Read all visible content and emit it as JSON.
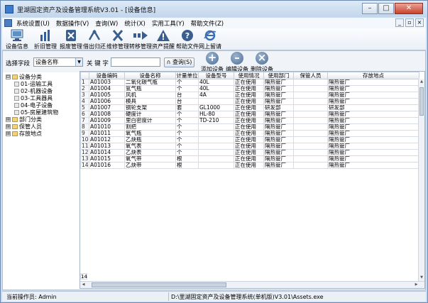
{
  "window": {
    "title": "里湖固定资产及设备管理系统V3.01 - [设备信息]",
    "buttons": {
      "minimize": "–",
      "maximize": "□",
      "close": "✕"
    }
  },
  "menubar": {
    "items": [
      "系统设置(U)",
      "数据操作(V)",
      "查询(W)",
      "统计(X)",
      "实用工具(Y)",
      "帮助文件(Z)"
    ],
    "mdi_buttons": [
      "_",
      "▫",
      "×"
    ]
  },
  "toolbar": {
    "items": [
      {
        "label": "设备信息",
        "icon": "monitor-icon"
      },
      {
        "label": "折旧管理",
        "icon": "barchart-icon"
      },
      {
        "label": "报废管理",
        "icon": "scrap-icon"
      },
      {
        "label": "借出归还",
        "icon": "lend-icon"
      },
      {
        "label": "维修管理",
        "icon": "tools-icon"
      },
      {
        "label": "转移管理",
        "icon": "transfer-icon"
      },
      {
        "label": "资产提醒",
        "icon": "warning-icon"
      },
      {
        "label": "帮助文件",
        "icon": "help-icon"
      },
      {
        "label": "网上留请",
        "icon": "ie-icon"
      }
    ]
  },
  "search": {
    "field_label": "选择字段",
    "field_value": "设备名称",
    "keyword_label": "关 键 字",
    "keyword_value": "",
    "query_button": "查询(S)"
  },
  "actions": {
    "add": "添加设备",
    "edit": "编辑设备",
    "delete": "删除设备"
  },
  "tree": [
    {
      "label": "设备分类",
      "expander": "⊟",
      "level": 0
    },
    {
      "label": "01-运输工具",
      "level": 1
    },
    {
      "label": "02-机器设备",
      "level": 1
    },
    {
      "label": "03-工具器具",
      "level": 1
    },
    {
      "label": "04-电子设备",
      "level": 1
    },
    {
      "label": "05-房屋建筑物",
      "level": 1
    },
    {
      "label": "部门分类",
      "expander": "⊞",
      "level": 0
    },
    {
      "label": "保管人员",
      "expander": "⊞",
      "level": 0
    },
    {
      "label": "存放地点",
      "expander": "⊞",
      "level": 0
    }
  ],
  "table": {
    "columns": [
      "",
      "设备编码",
      "设备名称",
      "计量单位",
      "设备型号",
      "使用情况",
      "使用部门",
      "保管人员",
      "存放地点"
    ],
    "rows": [
      [
        "1",
        "A01003",
        "二氧化碳气瓶",
        "个",
        "40L",
        "正在使用",
        "隔热管厂",
        "",
        "隔热管厂"
      ],
      [
        "2",
        "A01004",
        "氩气瓶",
        "个",
        "40L",
        "正在使用",
        "隔热管厂",
        "",
        "隔热管厂"
      ],
      [
        "3",
        "A01005",
        "风机",
        "台",
        "4A",
        "正在使用",
        "隔热管厂",
        "",
        "隔热管厂"
      ],
      [
        "4",
        "A01006",
        "模具",
        "台",
        "",
        "正在使用",
        "隔热管厂",
        "",
        "隔热管厂"
      ],
      [
        "5",
        "A01007",
        "钢轮支架",
        "套",
        "GL1000",
        "正在使用",
        "研发部",
        "",
        "研发部"
      ],
      [
        "6",
        "A01008",
        "硬度计",
        "个",
        "HL-80",
        "正在使用",
        "隔热管厂",
        "",
        "隔热管厂"
      ],
      [
        "7",
        "A01009",
        "里白密度计",
        "个",
        "TD-210",
        "正在使用",
        "隔热管厂",
        "",
        "隔热管厂"
      ],
      [
        "8",
        "A01010",
        "割把",
        "个",
        "",
        "正在使用",
        "隔热管厂",
        "",
        "隔热管厂"
      ],
      [
        "9",
        "A01011",
        "氧气瓶",
        "个",
        "",
        "正在使用",
        "隔热管厂",
        "",
        "隔热管厂"
      ],
      [
        "10",
        "A01012",
        "乙炔瓶",
        "个",
        "",
        "正在使用",
        "隔热管厂",
        "",
        "隔热管厂"
      ],
      [
        "11",
        "A01013",
        "氧气表",
        "个",
        "",
        "正在使用",
        "隔热管厂",
        "",
        "隔热管厂"
      ],
      [
        "12",
        "A01014",
        "乙炔表",
        "个",
        "",
        "正在使用",
        "隔热管厂",
        "",
        "隔热管厂"
      ],
      [
        "13",
        "A01015",
        "氧气带",
        "根",
        "",
        "正在使用",
        "隔热管厂",
        "",
        "隔热管厂"
      ],
      [
        "14",
        "A01016",
        "乙炔带",
        "根",
        "",
        "正在使用",
        "隔热管厂",
        "",
        "隔热管厂"
      ]
    ],
    "empty_row_number": "14"
  },
  "statusbar": {
    "operator": "当前操作员: Admin",
    "path": "D:\\里湖固定资产及设备管理系统(单机版)V3.01\\Assets.exe"
  }
}
